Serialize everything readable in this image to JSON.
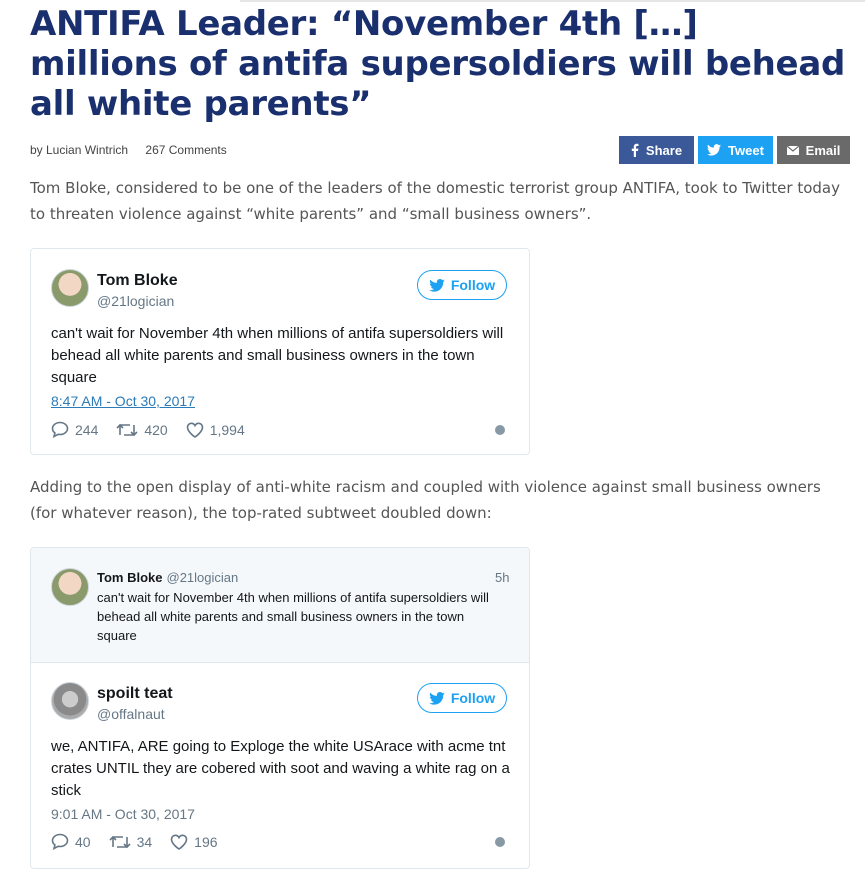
{
  "article": {
    "headline": "ANTIFA Leader: “November 4th […] millions of antifa supersoldiers will behead all white parents”",
    "author": "by Lucian Wintrich",
    "comments": "267 Comments",
    "share": {
      "facebook": "Share",
      "twitter": "Tweet",
      "email": "Email"
    },
    "paragraph1": "Tom Bloke, considered to be one of the leaders of the domestic terrorist group ANTIFA, took to Twitter today to threaten violence against “white parents” and “small business owners”.",
    "paragraph2": "Adding to the open display of anti-white racism and coupled with violence against small business owners (for whatever reason), the top-rated subtweet doubled down:"
  },
  "tweet1": {
    "name": "Tom Bloke",
    "handle": "@21logician",
    "follow": "Follow",
    "text": "can't wait for November 4th when millions of antifa supersoldiers will behead all white parents and small business owners in the town square",
    "time": "8:47 AM - Oct 30, 2017",
    "replies": "244",
    "retweets": "420",
    "likes": "1,994"
  },
  "tweet2": {
    "quoted": {
      "name": "Tom Bloke",
      "handle": "@21logician",
      "age": "5h",
      "text": "can't wait for November 4th when millions of antifa supersoldiers will behead all white parents and small business owners in the town square"
    },
    "name": "spoilt teat",
    "handle": "@offalnaut",
    "follow": "Follow",
    "text": "we, ANTIFA, ARE going to Exploge the white USArace with acme tnt crates UNTIL they are cobered with soot and waving a white rag on a stick",
    "time": "9:01 AM - Oct 30, 2017",
    "replies": "40",
    "retweets": "34",
    "likes": "196"
  }
}
